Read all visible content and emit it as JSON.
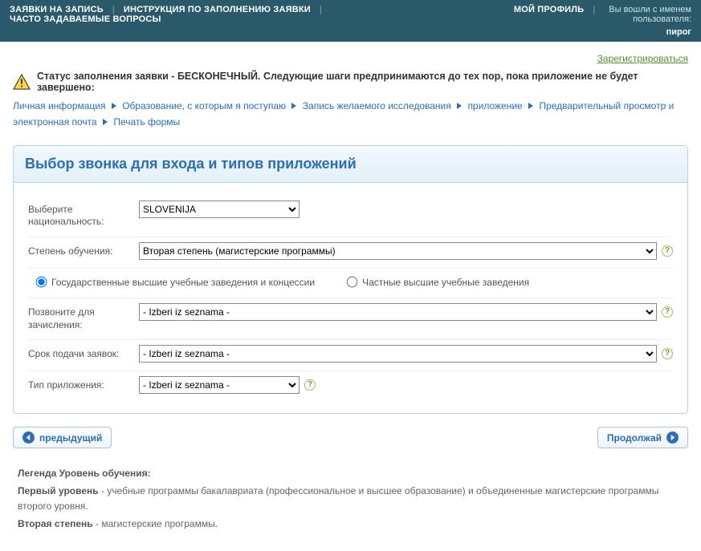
{
  "topnav": {
    "links": [
      "ЗАЯВКИ НА ЗАПИСЬ",
      "ИНСТРУКЦИЯ ПО ЗАПОЛНЕНИЮ ЗАЯВКИ",
      "ЧАСТО ЗАДАВАЕМЫЕ ВОПРОСЫ"
    ],
    "profile": "МОЙ ПРОФИЛЬ",
    "logged_in_as": "Вы вошли с именем пользователя:",
    "username": "пирог"
  },
  "register_link": "Зарегистрироваться",
  "status": "Статус заполнения заявки - БЕСКОНЕЧНЫЙ. Следующие шаги предпринимаются до тех пор, пока приложение не будет завершено:",
  "breadcrumb": [
    "Личная информация",
    "Образование, с которым я поступаю",
    "Запись желаемого исследования",
    "приложение",
    "Предварительный просмотр и электронная почта",
    "Печать формы"
  ],
  "panel_title": "Выбор звонка для входа и типов приложений",
  "form": {
    "nationality": {
      "label": "Выберите национальность:",
      "value": "SLOVENIJA"
    },
    "degree": {
      "label": "Степень обучения:",
      "value": "Вторая степень (магистерские программы)"
    },
    "institution_type": {
      "option_public": "Государственные высшие учебные заведения и концессии",
      "option_private": "Частные высшие учебные заведения",
      "selected": "public"
    },
    "call": {
      "label": "Позвоните для зачисления:",
      "value": "- Izberi iz seznama -"
    },
    "deadline": {
      "label": "Срок подачи заявок:",
      "value": "- Izberi iz seznama -"
    },
    "app_type": {
      "label": "Тип приложения:",
      "value": "- Izberi iz seznama -"
    }
  },
  "buttons": {
    "prev": "предыдущий",
    "next": "Продолжай"
  },
  "legend": {
    "heading": "Легенда Уровень обучения:",
    "line1_b": "Первый уровень",
    "line1": " - учебные программы бакалавриата (профессиональное и высшее образование) и объединенные магистерские программы второго уровня.",
    "line2_b": "Вторая степень",
    "line2": " - магистерские программы."
  }
}
